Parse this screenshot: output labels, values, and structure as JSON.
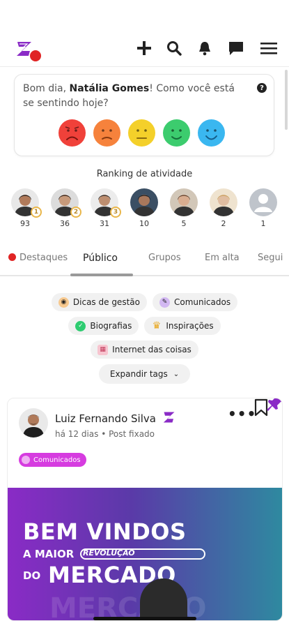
{
  "greeting": {
    "prefix": "Bom dia, ",
    "name": "Natália Gomes",
    "suffix": "! Como você está se sentindo hoje?"
  },
  "moods": [
    {
      "name": "very-sad",
      "color": "#f0413a"
    },
    {
      "name": "sad",
      "color": "#f6823c"
    },
    {
      "name": "neutral",
      "color": "#f4d02a"
    },
    {
      "name": "happy",
      "color": "#3ccc6e"
    },
    {
      "name": "very-happy",
      "color": "#3ab7f0"
    }
  ],
  "ranking": {
    "title": "Ranking de atividade",
    "people": [
      {
        "count": "93",
        "medal": "1",
        "skin": "#b07a5a",
        "hair": "#1e1e1e",
        "bg": "#e8e8e8"
      },
      {
        "count": "36",
        "medal": "2",
        "skin": "#c79a7b",
        "hair": "#2a1b12",
        "bg": "#dcdcdc"
      },
      {
        "count": "31",
        "medal": "3",
        "skin": "#bd8e70",
        "hair": "#2b2b2b",
        "bg": "#ececec"
      },
      {
        "count": "10",
        "medal": "",
        "skin": "#a9785c",
        "hair": "#1a1a1a",
        "bg": "#3b4f64"
      },
      {
        "count": "5",
        "medal": "",
        "skin": "#d9ad90",
        "hair": "#5a3b28",
        "bg": "#d2c7b8"
      },
      {
        "count": "2",
        "medal": "",
        "skin": "#e0bda1",
        "hair": "#c9a15e",
        "bg": "#efe3cf"
      },
      {
        "count": "1",
        "medal": "",
        "skin": "#ffffff",
        "hair": "#bfc4cb",
        "bg": "#bfc4cb"
      }
    ]
  },
  "tabs": [
    {
      "label": "Destaques",
      "active": false
    },
    {
      "label": "Público",
      "active": true
    },
    {
      "label": "Grupos",
      "active": false
    },
    {
      "label": "Em alta",
      "active": false
    },
    {
      "label": "Segui",
      "active": false
    }
  ],
  "tags": [
    {
      "label": "Dicas de gestão",
      "icon": "tip-icon",
      "color": "#f4a261"
    },
    {
      "label": "Comunicados",
      "icon": "megaphone-icon",
      "color": "#b58be6"
    },
    {
      "label": "Biografias",
      "icon": "check-icon",
      "color": "#2ecc71"
    },
    {
      "label": "Inspirações",
      "icon": "trophy-icon",
      "color": "#e9a820"
    },
    {
      "label": "Internet das coisas",
      "icon": "calendar-icon",
      "color": "#e25b7a"
    }
  ],
  "expand_label": "Expandir tags",
  "post": {
    "author": "Luiz Fernando Silva",
    "meta": "há 12 dias • Post fixado",
    "tag": "Comunicados",
    "banner": {
      "line1": "BEM VINDOS",
      "line2a": "A MAIOR",
      "line2b": "REVOLUÇÃO",
      "line3a": "DO",
      "line3b": "MERCADO",
      "ghost": "MERCADO"
    }
  },
  "colors": {
    "brand": "#8a2bc6",
    "accent_red": "#e02424",
    "pin": "#8a2bc6"
  }
}
